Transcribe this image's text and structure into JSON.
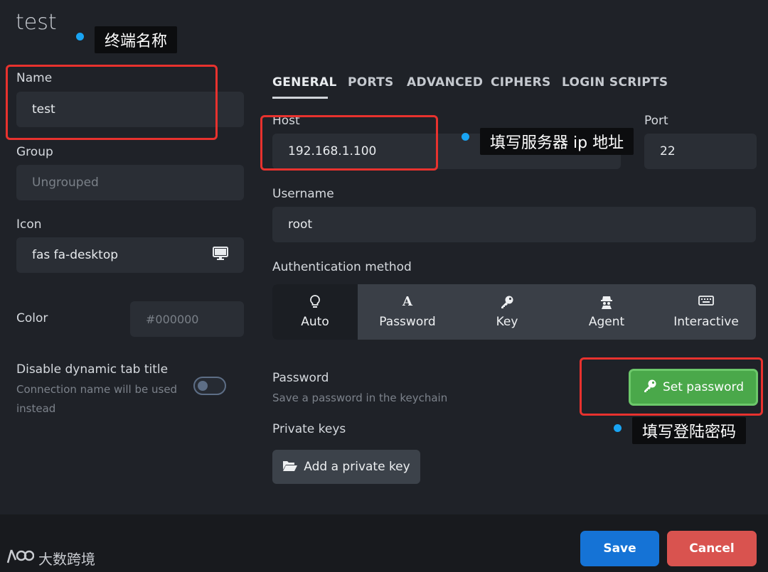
{
  "title": "test",
  "left": {
    "name_label": "Name",
    "name_value": "test",
    "group_label": "Group",
    "group_placeholder": "Ungrouped",
    "icon_label": "Icon",
    "icon_value": "fas fa-desktop",
    "icon_preview": "desktop-icon",
    "color_label": "Color",
    "color_placeholder": "#000000",
    "disable_title_label": "Disable dynamic tab title",
    "disable_title_desc_1": "Connection name will be used",
    "disable_title_desc_2": "instead",
    "disable_title_on": false
  },
  "tabs": [
    {
      "label": "GENERAL",
      "active": true
    },
    {
      "label": "PORTS"
    },
    {
      "label": "ADVANCED"
    },
    {
      "label": "CIPHERS"
    },
    {
      "label": "LOGIN SCRIPTS"
    }
  ],
  "general": {
    "host_label": "Host",
    "host_value": "192.168.1.100",
    "port_label": "Port",
    "port_value": "22",
    "username_label": "Username",
    "username_value": "root",
    "auth_label": "Authentication method",
    "auth_options": [
      {
        "label": "Auto",
        "icon": "lightbulb-icon",
        "active": true
      },
      {
        "label": "Password",
        "icon": "font-a-icon"
      },
      {
        "label": "Key",
        "icon": "key-icon"
      },
      {
        "label": "Agent",
        "icon": "agent-icon"
      },
      {
        "label": "Interactive",
        "icon": "keyboard-icon"
      }
    ],
    "password_label": "Password",
    "password_desc": "Save a password in the keychain",
    "set_password_label": "Set password",
    "private_keys_label": "Private keys",
    "add_key_label": "Add a private key"
  },
  "footer": {
    "save_label": "Save",
    "cancel_label": "Cancel"
  },
  "annotations": {
    "name_callout": "终端名称",
    "host_callout": "填写服务器 ip 地址",
    "password_callout": "填写登陆密码"
  },
  "watermark": "大数跨境",
  "colors": {
    "accent_blue": "#1573d6",
    "danger_red": "#d9534f",
    "success_green": "#4aa84a",
    "annotation_red": "#e8322e",
    "annotation_dot": "#19a4f3"
  }
}
